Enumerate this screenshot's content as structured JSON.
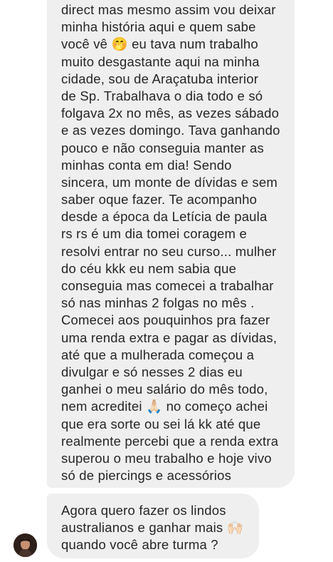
{
  "messages": [
    {
      "lines": [
        "direct mas mesmo assim vou deixar",
        "minha história aqui e quem sabe",
        "você vê 🤭 eu tava num trabalho",
        "muito desgastante aqui na minha",
        "cidade, sou de Araçatuba interior",
        "de Sp. Trabalhava o dia todo e só",
        "folgava 2x no mês, as vezes sábado",
        "e as vezes domingo. Tava ganhando",
        "pouco e não conseguia manter as",
        "minhas conta em dia! Sendo",
        "sincera, um monte de dívidas e sem",
        "saber oque fazer. Te acompanho",
        "desde a época da Letícia de paula",
        "rs rs é um dia tomei coragem e",
        "resolvi entrar no seu curso... mulher",
        "do céu kkk eu nem sabia que",
        "conseguia mas comecei a trabalhar",
        "só nas minhas 2 folgas no mês .",
        "Comecei aos pouquinhos pra fazer",
        "uma renda extra e pagar as dívidas,",
        "até que a mulherada começou a",
        "divulgar e só nesses 2 dias eu",
        "ganhei o meu salário do mês todo,",
        "nem acreditei 🙏🏻 no começo achei",
        "que era sorte ou sei lá kk até que",
        "realmente percebi que a renda extra",
        "superou o meu trabalho e hoje vivo",
        "só de piercings e acessórios"
      ]
    },
    {
      "lines": [
        "Agora quero fazer os lindos",
        "australianos e ganhar mais 🙌🏻",
        "quando você abre turma ?"
      ]
    }
  ]
}
